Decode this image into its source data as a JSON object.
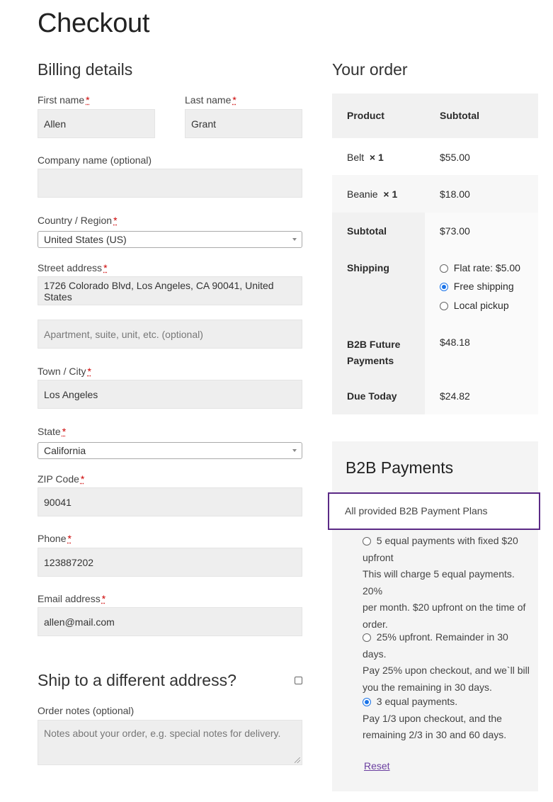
{
  "page": {
    "title": "Checkout"
  },
  "billing": {
    "heading": "Billing details",
    "first_name_label": "First name",
    "first_name_value": "Allen",
    "last_name_label": "Last name",
    "last_name_value": "Grant",
    "company_label": "Company name (optional)",
    "company_value": "",
    "country_label": "Country / Region",
    "country_value": "United States (US)",
    "street_label": "Street address",
    "street_value": "1726 Colorado Blvd, Los Angeles, CA 90041, United States",
    "apartment_placeholder": "Apartment, suite, unit, etc. (optional)",
    "city_label": "Town / City",
    "city_value": "Los Angeles",
    "state_label": "State",
    "state_value": "California",
    "zip_label": "ZIP Code",
    "zip_value": "90041",
    "phone_label": "Phone",
    "phone_value": "123887202",
    "email_label": "Email address",
    "email_value": "allen@mail.com",
    "required_marker": "*"
  },
  "ship_different": {
    "label": "Ship to a different address?",
    "checked": false
  },
  "order_notes": {
    "label": "Order notes (optional)",
    "placeholder": "Notes about your order, e.g. special notes for delivery."
  },
  "order": {
    "heading": "Your order",
    "col_product": "Product",
    "col_subtotal": "Subtotal",
    "items": [
      {
        "name": "Belt",
        "qty": "× 1",
        "price": "$55.00"
      },
      {
        "name": "Beanie",
        "qty": "× 1",
        "price": "$18.00"
      }
    ],
    "subtotal_label": "Subtotal",
    "subtotal_value": "$73.00",
    "shipping_label": "Shipping",
    "shipping_options": [
      {
        "label": "Flat rate: $5.00",
        "checked": false
      },
      {
        "label": "Free shipping",
        "checked": true
      },
      {
        "label": "Local pickup",
        "checked": false
      }
    ],
    "future_label_1": "B2B Future",
    "future_label_2": "Payments",
    "future_value": "$48.18",
    "due_label": "Due Today",
    "due_value": "$24.82"
  },
  "b2b": {
    "heading": "B2B Payments",
    "plans_header": "All provided B2B Payment Plans",
    "plans": [
      {
        "title_1": "5 equal payments with fixed $20",
        "title_2": "upfront",
        "desc": [
          "This will charge 5 equal payments. 20%",
          "per month. $20 upfront on the time of",
          "order."
        ],
        "checked": false
      },
      {
        "title_1": "25% upfront. Remainder in 30 days.",
        "desc": [
          "Pay 25% upon checkout, and we`ll bill",
          "you the remaining in 30 days."
        ],
        "checked": false
      },
      {
        "title_1": "3 equal payments.",
        "desc": [
          "Pay 1/3 upon checkout, and the",
          "remaining 2/3 in 30 and 60 days."
        ],
        "checked": true
      }
    ],
    "reset_label": "Reset",
    "highlight_color": "#5b2a86",
    "radio_accent": "#1a73e8"
  }
}
